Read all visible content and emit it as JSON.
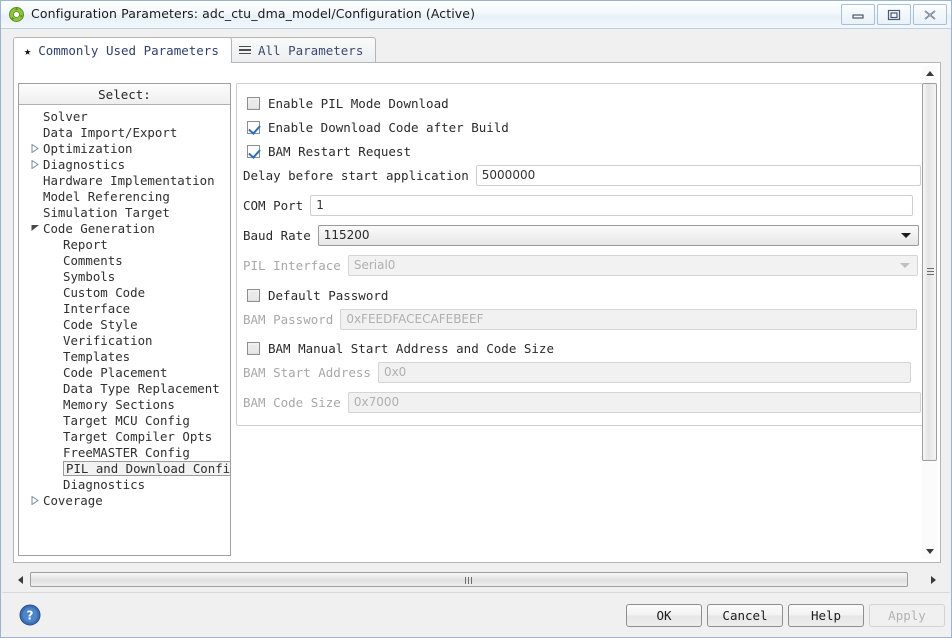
{
  "window": {
    "title": "Configuration Parameters: adc_ctu_dma_model/Configuration (Active)",
    "icon": "simulink-icon",
    "controls": {
      "minimize": "minimize-icon",
      "maximize": "maximize-icon",
      "close": "close-icon"
    }
  },
  "tabs": [
    {
      "label": "Commonly Used Parameters",
      "icon": "star-icon",
      "active": true
    },
    {
      "label": "All Parameters",
      "icon": "list-icon",
      "active": false
    }
  ],
  "tree": {
    "header": "Select:",
    "items": [
      {
        "label": "Solver",
        "indent": 0,
        "arrow": "none",
        "selected": false
      },
      {
        "label": "Data Import/Export",
        "indent": 0,
        "arrow": "none",
        "selected": false
      },
      {
        "label": "Optimization",
        "indent": 0,
        "arrow": "collapsed",
        "selected": false
      },
      {
        "label": "Diagnostics",
        "indent": 0,
        "arrow": "collapsed",
        "selected": false
      },
      {
        "label": "Hardware Implementation",
        "indent": 0,
        "arrow": "none",
        "selected": false
      },
      {
        "label": "Model Referencing",
        "indent": 0,
        "arrow": "none",
        "selected": false
      },
      {
        "label": "Simulation Target",
        "indent": 0,
        "arrow": "none",
        "selected": false
      },
      {
        "label": "Code Generation",
        "indent": 0,
        "arrow": "expanded",
        "selected": false
      },
      {
        "label": "Report",
        "indent": 1,
        "arrow": "none",
        "selected": false
      },
      {
        "label": "Comments",
        "indent": 1,
        "arrow": "none",
        "selected": false
      },
      {
        "label": "Symbols",
        "indent": 1,
        "arrow": "none",
        "selected": false
      },
      {
        "label": "Custom Code",
        "indent": 1,
        "arrow": "none",
        "selected": false
      },
      {
        "label": "Interface",
        "indent": 1,
        "arrow": "none",
        "selected": false
      },
      {
        "label": "Code Style",
        "indent": 1,
        "arrow": "none",
        "selected": false
      },
      {
        "label": "Verification",
        "indent": 1,
        "arrow": "none",
        "selected": false
      },
      {
        "label": "Templates",
        "indent": 1,
        "arrow": "none",
        "selected": false
      },
      {
        "label": "Code Placement",
        "indent": 1,
        "arrow": "none",
        "selected": false
      },
      {
        "label": "Data Type Replacement",
        "indent": 1,
        "arrow": "none",
        "selected": false
      },
      {
        "label": "Memory Sections",
        "indent": 1,
        "arrow": "none",
        "selected": false
      },
      {
        "label": "Target MCU Config",
        "indent": 1,
        "arrow": "none",
        "selected": false
      },
      {
        "label": "Target Compiler Opts",
        "indent": 1,
        "arrow": "none",
        "selected": false
      },
      {
        "label": "FreeMASTER Config",
        "indent": 1,
        "arrow": "none",
        "selected": false
      },
      {
        "label": "PIL and Download Config",
        "indent": 1,
        "arrow": "none",
        "selected": true
      },
      {
        "label": "Diagnostics",
        "indent": 1,
        "arrow": "none",
        "selected": false
      },
      {
        "label": "Coverage",
        "indent": 0,
        "arrow": "collapsed",
        "selected": false
      }
    ]
  },
  "form": {
    "enable_pil_mode_download": {
      "label": "Enable PIL Mode Download",
      "checked": false,
      "enabled": true
    },
    "enable_download_after_build": {
      "label": "Enable Download Code after Build",
      "checked": true,
      "enabled": true
    },
    "bam_restart_request": {
      "label": "BAM Restart Request",
      "checked": true,
      "enabled": true
    },
    "delay_before_start": {
      "label": "Delay before start application",
      "value": "5000000",
      "enabled": true
    },
    "com_port": {
      "label": "COM Port",
      "value": "1",
      "enabled": true
    },
    "baud_rate": {
      "label": "Baud Rate",
      "value": "115200",
      "enabled": true,
      "type": "combo"
    },
    "pil_interface": {
      "label": "PIL Interface",
      "value": "Serial0",
      "enabled": false,
      "type": "combo"
    },
    "default_password": {
      "label": "Default Password",
      "checked": false,
      "enabled": true
    },
    "bam_password": {
      "label": "BAM Password",
      "value": "0xFEEDFACECAFEBEEF",
      "enabled": false
    },
    "bam_manual_start": {
      "label": "BAM Manual Start Address and Code Size",
      "checked": false,
      "enabled": true
    },
    "bam_start_address": {
      "label": "BAM Start Address",
      "value": "0x0",
      "enabled": false
    },
    "bam_code_size": {
      "label": "BAM Code Size",
      "value": "0x7000",
      "enabled": false
    }
  },
  "footer": {
    "help_icon": "question-mark-icon",
    "buttons": [
      {
        "label": "OK",
        "enabled": true
      },
      {
        "label": "Cancel",
        "enabled": true
      },
      {
        "label": "Help",
        "enabled": true
      },
      {
        "label": "Apply",
        "enabled": false
      }
    ]
  },
  "colors": {
    "accent": "#2f6fb5",
    "title_bar": "#eef4fa",
    "selection": "#f2f2f2"
  }
}
